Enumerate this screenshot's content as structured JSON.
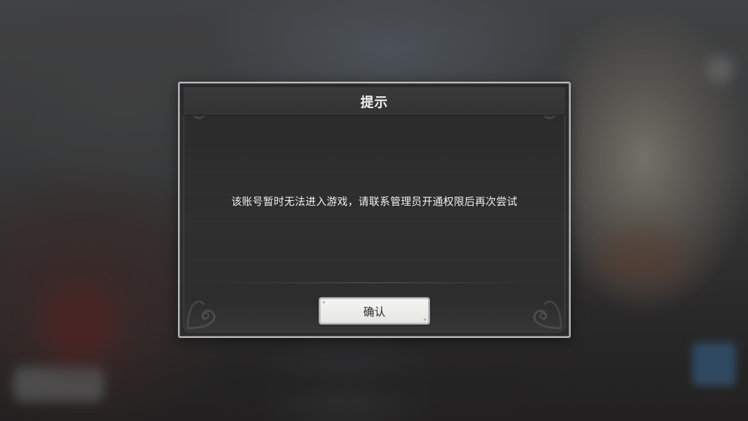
{
  "dialog": {
    "title": "提示",
    "message": "该账号暂时无法进入游戏，请联系管理员开通权限后再次尝试",
    "confirm_label": "确认"
  },
  "colors": {
    "dialog_background": "#2d2d2d",
    "dialog_border": "#b9bbbd",
    "button_background": "#eeeeec",
    "button_text": "#2a2a2a",
    "title_text": "#f2f2f2"
  },
  "icons": {
    "corner_ornament": "scroll-ornament-icon"
  }
}
